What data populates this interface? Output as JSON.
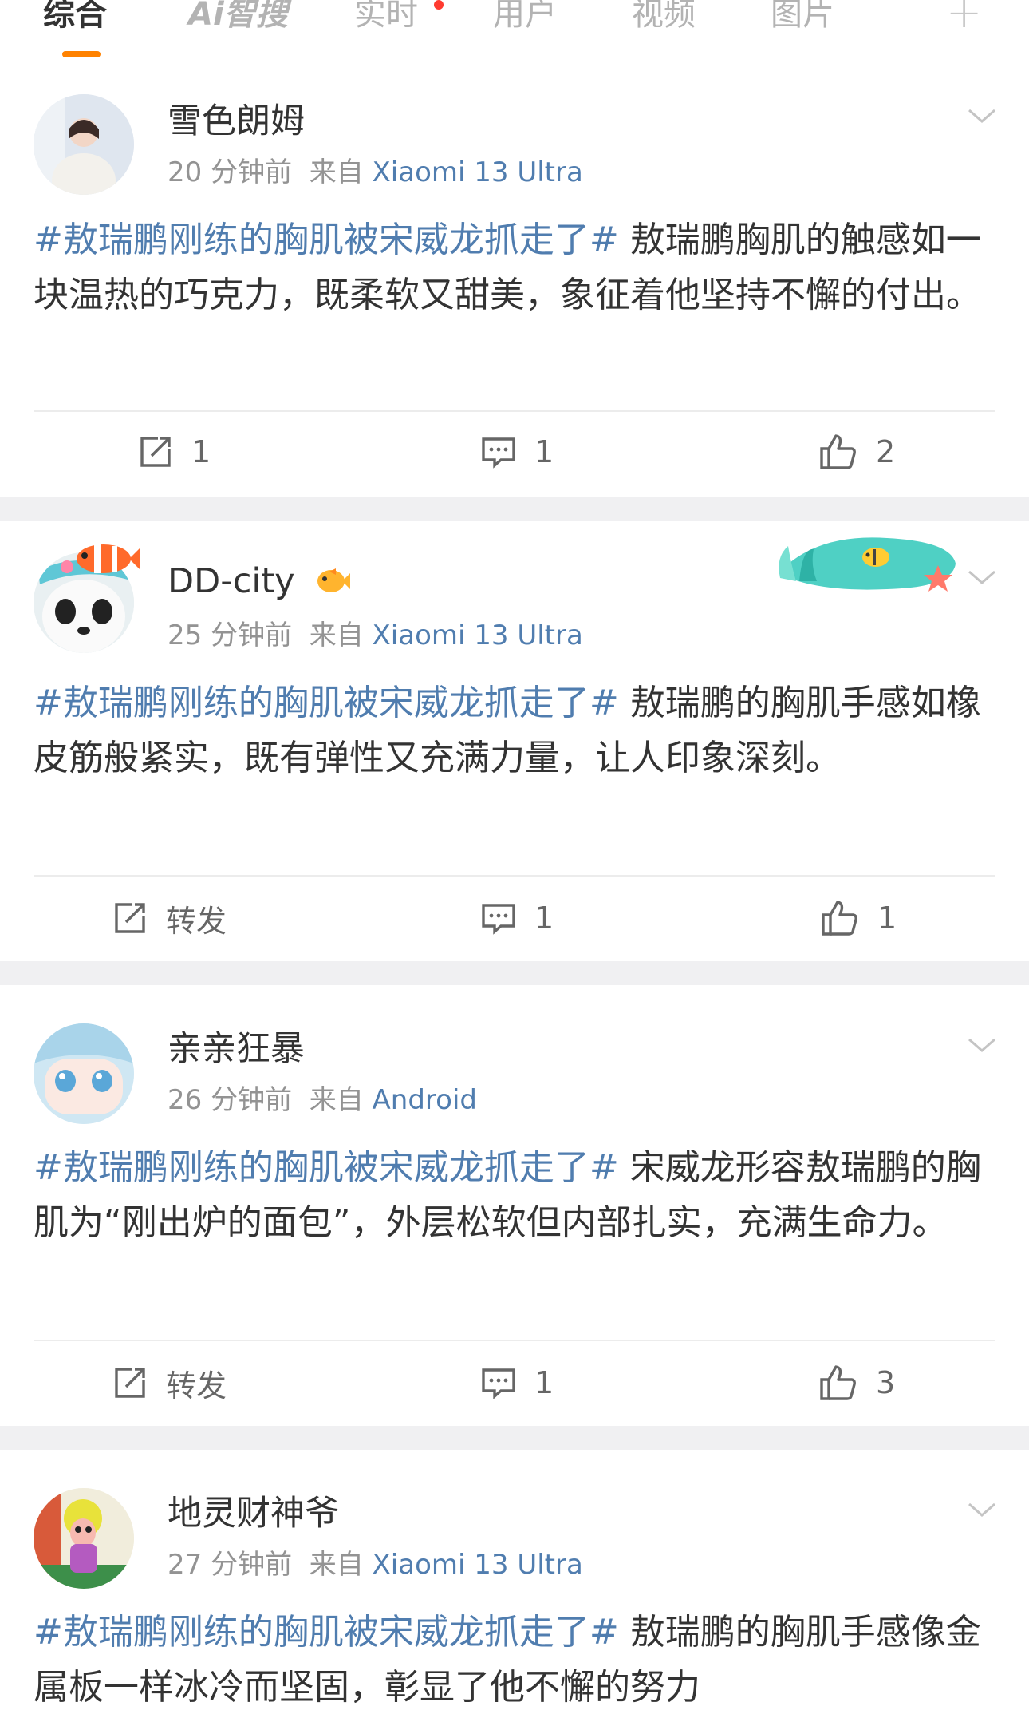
{
  "tabs": [
    {
      "label": "综合"
    },
    {
      "label": "Ai智搜"
    },
    {
      "label": "实时"
    },
    {
      "label": "用户"
    },
    {
      "label": "视频"
    },
    {
      "label": "图片"
    }
  ],
  "tabs_plus": "+",
  "accent": "#ff8200",
  "link_color": "#507daf",
  "posts": [
    {
      "username": "雪色朗姆",
      "time": "20 分钟前",
      "from_label": "来自",
      "source": "Xiaomi 13 Ultra",
      "topic": "#敖瑞鹏刚练的胸肌被宋威龙抓走了#",
      "body": " 敖瑞鹏胸肌的触感如一块温热的巧克力，既柔软又甜美，象征着他坚持不懈的付出。",
      "repost": "1",
      "comment": "1",
      "like": "2"
    },
    {
      "username": "DD-city",
      "time": "25 分钟前",
      "from_label": "来自",
      "source": "Xiaomi 13 Ultra",
      "topic": "#敖瑞鹏刚练的胸肌被宋威龙抓走了#",
      "body": " 敖瑞鹏的胸肌手感如橡皮筋般紧实，既有弹性又充满力量，让人印象深刻。",
      "repost": "转发",
      "comment": "1",
      "like": "1"
    },
    {
      "username": "亲亲狂暴",
      "time": "26 分钟前",
      "from_label": "来自",
      "source": "Android",
      "topic": "#敖瑞鹏刚练的胸肌被宋威龙抓走了#",
      "body": " 宋威龙形容敖瑞鹏的胸肌为“刚出炉的面包”，外层松软但内部扎实，充满生命力。",
      "repost": "转发",
      "comment": "1",
      "like": "3"
    },
    {
      "username": "地灵财神爷",
      "time": "27 分钟前",
      "from_label": "来自",
      "source": "Xiaomi 13 Ultra",
      "topic": "#敖瑞鹏刚练的胸肌被宋威龙抓走了#",
      "body": " 敖瑞鹏的胸肌手感像金属板一样冰冷而坚固，彰显了他不懈的努力"
    }
  ]
}
